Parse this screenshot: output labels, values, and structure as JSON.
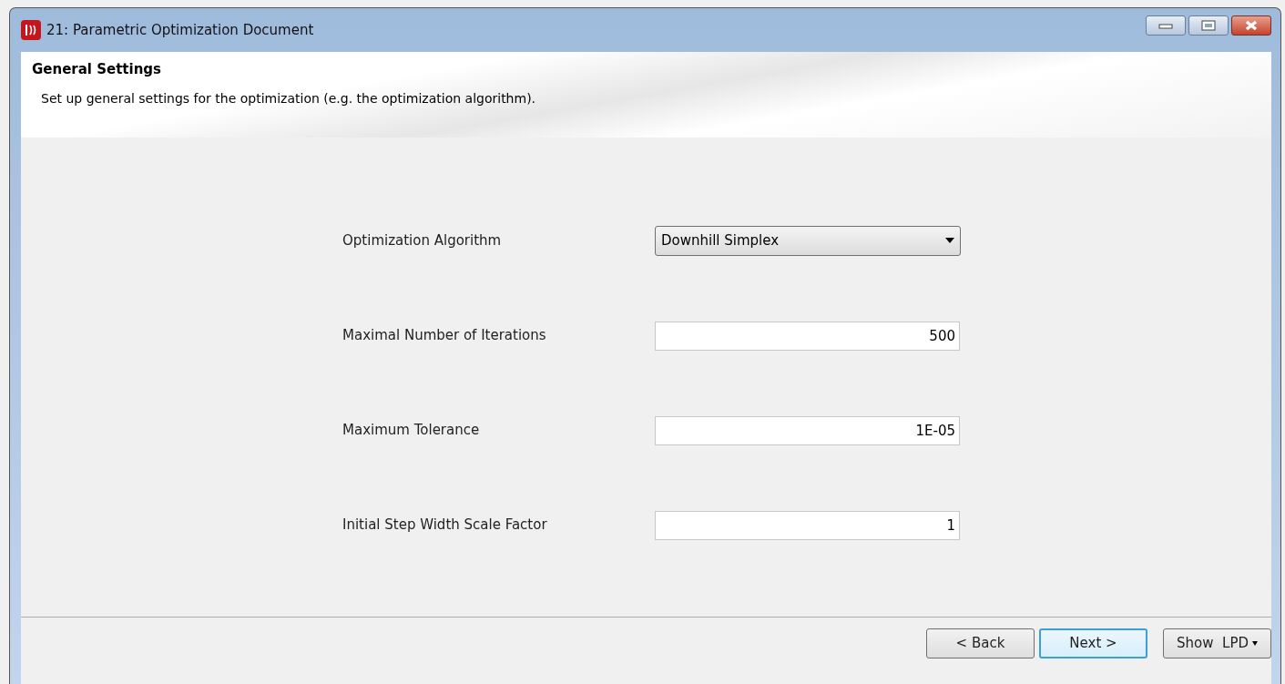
{
  "window": {
    "title": "21: Parametric Optimization Document"
  },
  "header": {
    "title": "General Settings",
    "description": "Set up general settings for the optimization (e.g. the optimization algorithm)."
  },
  "settings": [
    {
      "label": "Optimization Algorithm",
      "kind": "dropdown",
      "value": "Downhill Simplex"
    },
    {
      "label": "Maximal Number of Iterations",
      "kind": "number",
      "value": "500"
    },
    {
      "label": "Maximum Tolerance",
      "kind": "number",
      "value": "1E-05"
    },
    {
      "label": "Initial Step Width Scale Factor",
      "kind": "number",
      "value": "1"
    }
  ],
  "buttons": [
    {
      "label": "< Back",
      "focused": false,
      "kind": "plain"
    },
    {
      "label": "Next >",
      "focused": true,
      "kind": "plain"
    },
    {
      "label": "Show  LPD",
      "focused": false,
      "kind": "menu"
    }
  ]
}
